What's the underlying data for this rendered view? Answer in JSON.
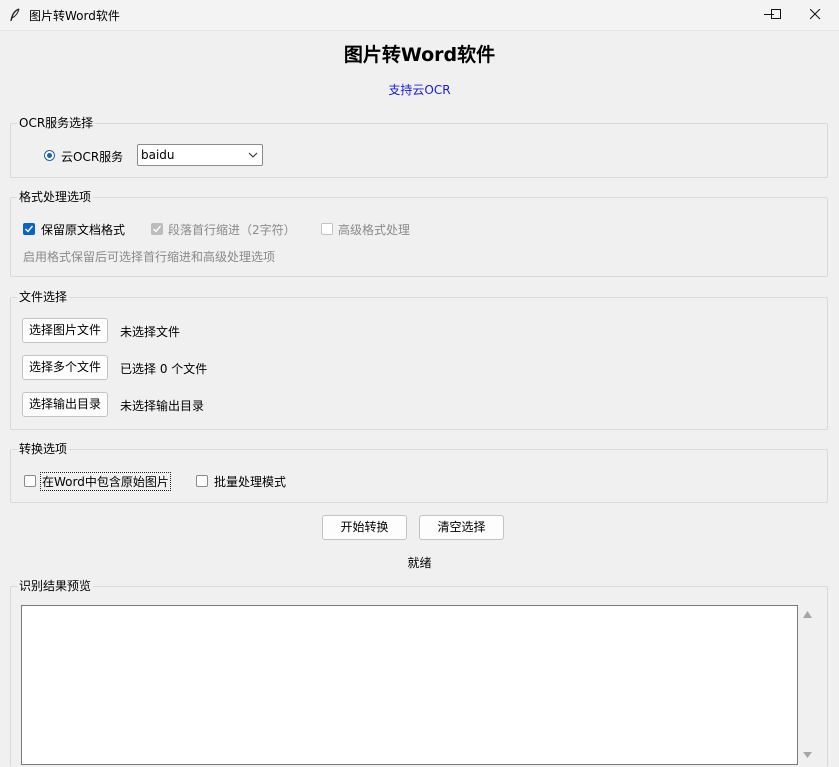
{
  "window": {
    "title": "图片转Word软件",
    "controls": [
      "minimize-icon",
      "maximize-icon",
      "close-icon"
    ]
  },
  "header": {
    "title": "图片转Word软件",
    "subtitle": "支持云OCR",
    "subtitle_color": "#1a1ad8"
  },
  "ocr_section": {
    "label": "OCR服务选择",
    "radio_label": "云OCR服务",
    "radio_selected": true,
    "service_value": "baidu"
  },
  "format_section": {
    "label": "格式处理选项",
    "keep_format": {
      "label": "保留原文档格式",
      "checked": true
    },
    "indent": {
      "label": "段落首行缩进（2字符）",
      "checked": true,
      "enabled": false
    },
    "advanced": {
      "label": "高级格式处理",
      "checked": false,
      "enabled": false
    },
    "hint": "启用格式保留后可选择首行缩进和高级处理选项"
  },
  "file_section": {
    "label": "文件选择",
    "select_image_button": "选择图片文件",
    "select_image_status": "未选择文件",
    "select_multi_button": "选择多个文件",
    "select_multi_status": "已选择 0 个文件",
    "select_output_button": "选择输出目录",
    "select_output_status": "未选择输出目录"
  },
  "convert_section": {
    "label": "转换选项",
    "include_images": {
      "label": "在Word中包含原始图片",
      "checked": false
    },
    "batch_mode": {
      "label": "批量处理模式",
      "checked": false
    }
  },
  "actions": {
    "start_button": "开始转换",
    "clear_button": "清空选择"
  },
  "status": "就绪",
  "preview": {
    "label": "识别结果预览",
    "content": ""
  },
  "colors": {
    "accent": "#0b62c6",
    "background": "#f0f0f0"
  }
}
